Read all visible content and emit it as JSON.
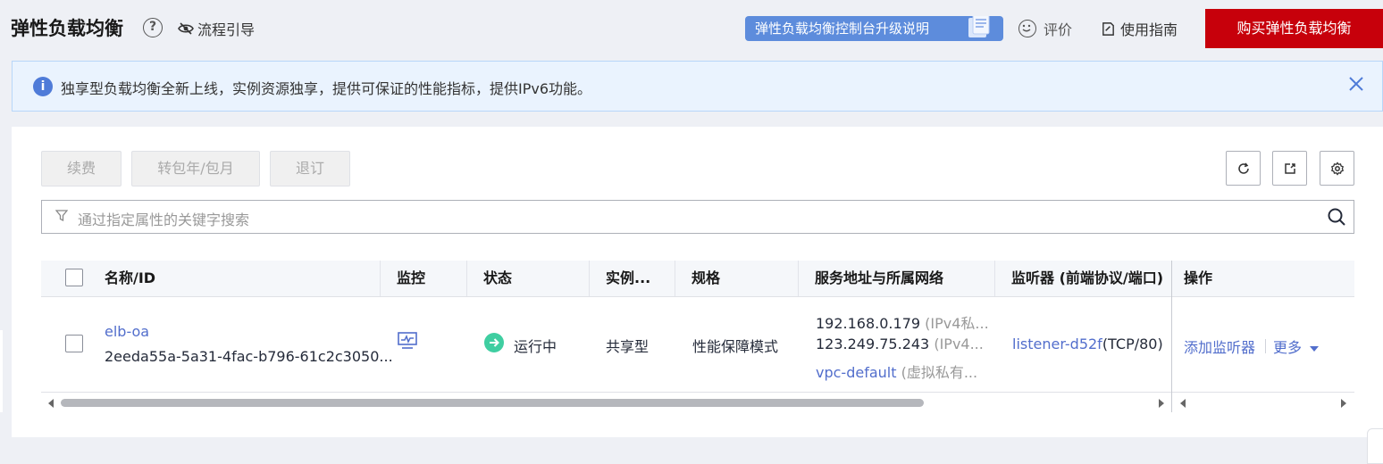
{
  "header": {
    "title": "弹性负载均衡",
    "help_symbol": "?",
    "guide_label": "流程引导",
    "upgrade_label": "弹性负载均衡控制台升级说明",
    "rate_label": "评价",
    "guide2_label": "使用指南",
    "buy_label": "购买弹性负载均衡"
  },
  "notice": {
    "info_symbol": "i",
    "text": "独享型负载均衡全新上线，实例资源独享，提供可保证的性能指标，提供IPv6功能。"
  },
  "toolbar": {
    "renew_label": "续费",
    "convert_label": "转包年/包月",
    "unsubscribe_label": "退订"
  },
  "search": {
    "placeholder": "通过指定属性的关键字搜索"
  },
  "table": {
    "headers": {
      "name": "名称/ID",
      "monitor": "监控",
      "status": "状态",
      "instance_type": "实例...",
      "spec": "规格",
      "address": "服务地址与所属网络",
      "listener": "监听器 (前端协议/端口)",
      "actions": "操作"
    },
    "rows": [
      {
        "name": "elb-oa",
        "id": "2eeda55a-5a31-4fac-b796-61c2c3050...",
        "status": "运行中",
        "instance_type": "共享型",
        "spec": "性能保障模式",
        "ip1": "192.168.0.179",
        "ip1_note": "(IPv4私...",
        "ip2": "123.249.75.243",
        "ip2_note": "(IPv4...",
        "vpc": "vpc-default",
        "vpc_note": "(虚拟私有...",
        "listener_link": "listener-d52f",
        "listener_proto": "(TCP/80)",
        "add_listener": "添加监听器",
        "more": "更多"
      }
    ]
  },
  "colors": {
    "brand_red": "#c7000b",
    "link_blue": "#526ecc",
    "status_green": "#3fcea1"
  }
}
